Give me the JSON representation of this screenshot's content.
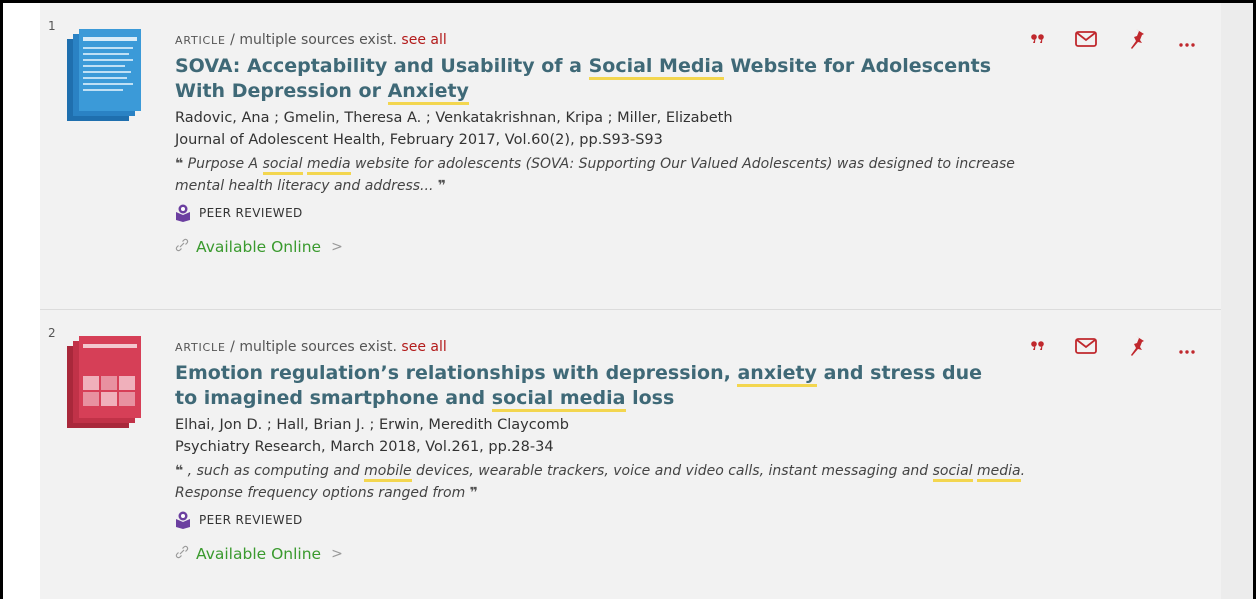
{
  "results": [
    {
      "number": "1",
      "type": "Article",
      "sources_note": " / multiple sources exist. ",
      "see_all": "see all",
      "title_parts": [
        "SOVA: Acceptability and Usability of a ",
        "Social Media",
        " Website for Adolescents",
        "With Depression or ",
        "Anxiety"
      ],
      "authors": "Radovic, Ana ; Gmelin, Theresa A. ; Venkatakrishnan, Kripa ; Miller, Elizabeth",
      "source": "Journal of Adolescent Health, February 2017, Vol.60(2), pp.S93-S93",
      "snippet_parts": [
        " Purpose A ",
        "social",
        " ",
        "media",
        " website for adolescents (SOVA: Supporting Our Valued Adolescents) was designed to increase",
        "mental health literacy and address... "
      ],
      "peer_reviewed": "PEER REVIEWED",
      "available": "Available Online",
      "thumb_color": "#2f8fd0"
    },
    {
      "number": "2",
      "type": "Article",
      "sources_note": " / multiple sources exist. ",
      "see_all": "see all",
      "title_parts": [
        "Emotion regulation’s relationships with depression, ",
        "anxiety",
        " and stress due",
        "to imagined smartphone and ",
        "social media",
        " loss"
      ],
      "authors": "Elhai, Jon D. ; Hall, Brian J. ; Erwin, Meredith Claycomb",
      "source": "Psychiatry Research, March 2018, Vol.261, pp.28-34",
      "snippet_parts": [
        " , such as computing and ",
        "mobile",
        " devices, wearable trackers, voice and video calls, instant messaging and ",
        "social",
        " ",
        "media",
        ".",
        "Response frequency options ranged from "
      ],
      "peer_reviewed": "PEER REVIEWED",
      "available": "Available Online",
      "thumb_color": "#c8344a"
    }
  ],
  "colors": {
    "title": "#3f6977",
    "accent_red": "#b31b1b",
    "available_green": "#3a9a2e",
    "highlight": "#f3d64f",
    "peer_purple": "#6b3fa0"
  },
  "icons": [
    "quote-icon",
    "email-icon",
    "pin-icon",
    "more-icon",
    "peer-reviewed-icon",
    "link-icon",
    "chevron-right-icon"
  ]
}
